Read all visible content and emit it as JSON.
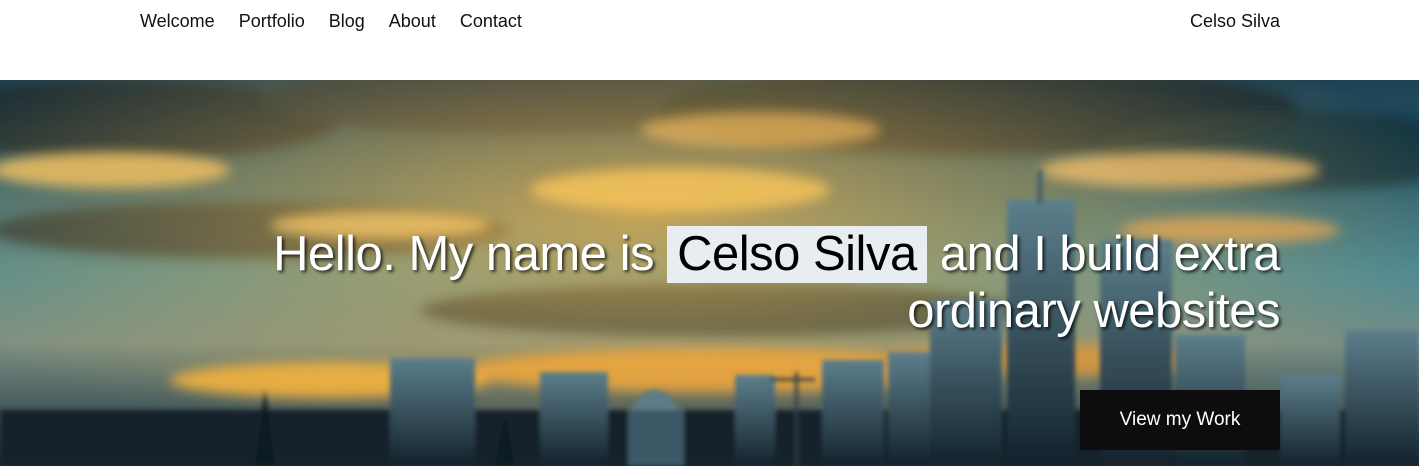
{
  "nav": {
    "links": [
      "Welcome",
      "Portfolio",
      "Blog",
      "About",
      "Contact"
    ],
    "brand": "Celso Silva"
  },
  "hero": {
    "headline_pre": "Hello. My name is",
    "headline_name": "Celso Silva",
    "headline_post": "and I build extra ordinary websites",
    "cta_label": "View my Work",
    "background": "city-skyline-sunset-image"
  },
  "colors": {
    "name_highlight": "#e8edf2",
    "cta_background": "#0d0d0d"
  }
}
